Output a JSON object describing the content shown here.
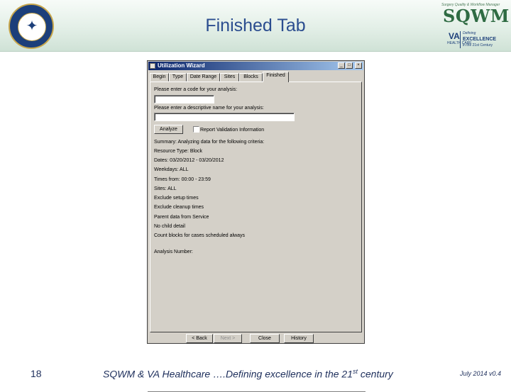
{
  "slide": {
    "title": "Finished Tab",
    "page_number": "18",
    "footer_text_before_sup": "SQWM & VA Healthcare ….Defining excellence in the 21",
    "footer_sup": "st",
    "footer_text_after_sup": " century",
    "footer_date": "July 2014 v0.4"
  },
  "logos": {
    "seal_icon": "federal-health-care-seal",
    "sqwm_tagline": "Surgery Quality & Workflow Manager",
    "sqwm": "SQWM",
    "va": "VA",
    "va_care": "HEALTH CARE",
    "defining": "Defining",
    "excellence": "EXCELLENCE",
    "century": "in the 21st Century"
  },
  "window": {
    "title": "Utilization Wizard",
    "controls": {
      "minimize": "_",
      "maximize": "□",
      "close": "×"
    },
    "tabs": [
      {
        "label": "Begin"
      },
      {
        "label": "Type"
      },
      {
        "label": "Date Range"
      },
      {
        "label": "Sites"
      },
      {
        "label": "Blocks"
      },
      {
        "label": "Finished"
      }
    ],
    "active_tab": "Finished",
    "code_prompt": "Please enter a code for your analysis:",
    "code_value": "",
    "name_prompt": "Please enter a descriptive name for your analysis:",
    "name_value": "",
    "analyze_button": "Analyze",
    "report_checkbox_label": "Report Validation Information",
    "report_checked": false,
    "summary_lines": [
      "Summary:  Analyzing data for the following criteria:",
      "Resource Type: Block",
      "Dates: 03/20/2012 - 03/20/2012",
      "Weekdays: ALL",
      "Times from: 00:00 - 23:59",
      "Sites: ALL",
      "Exclude setup times",
      "Exclude cleanup times",
      "Parent data from Service",
      "No child detail",
      "Count blocks for cases scheduled always"
    ],
    "analysis_number_label": "Analysis Number:",
    "buttons": {
      "back": "< Back",
      "next": "Next >",
      "close": "Close",
      "history": "History"
    }
  }
}
